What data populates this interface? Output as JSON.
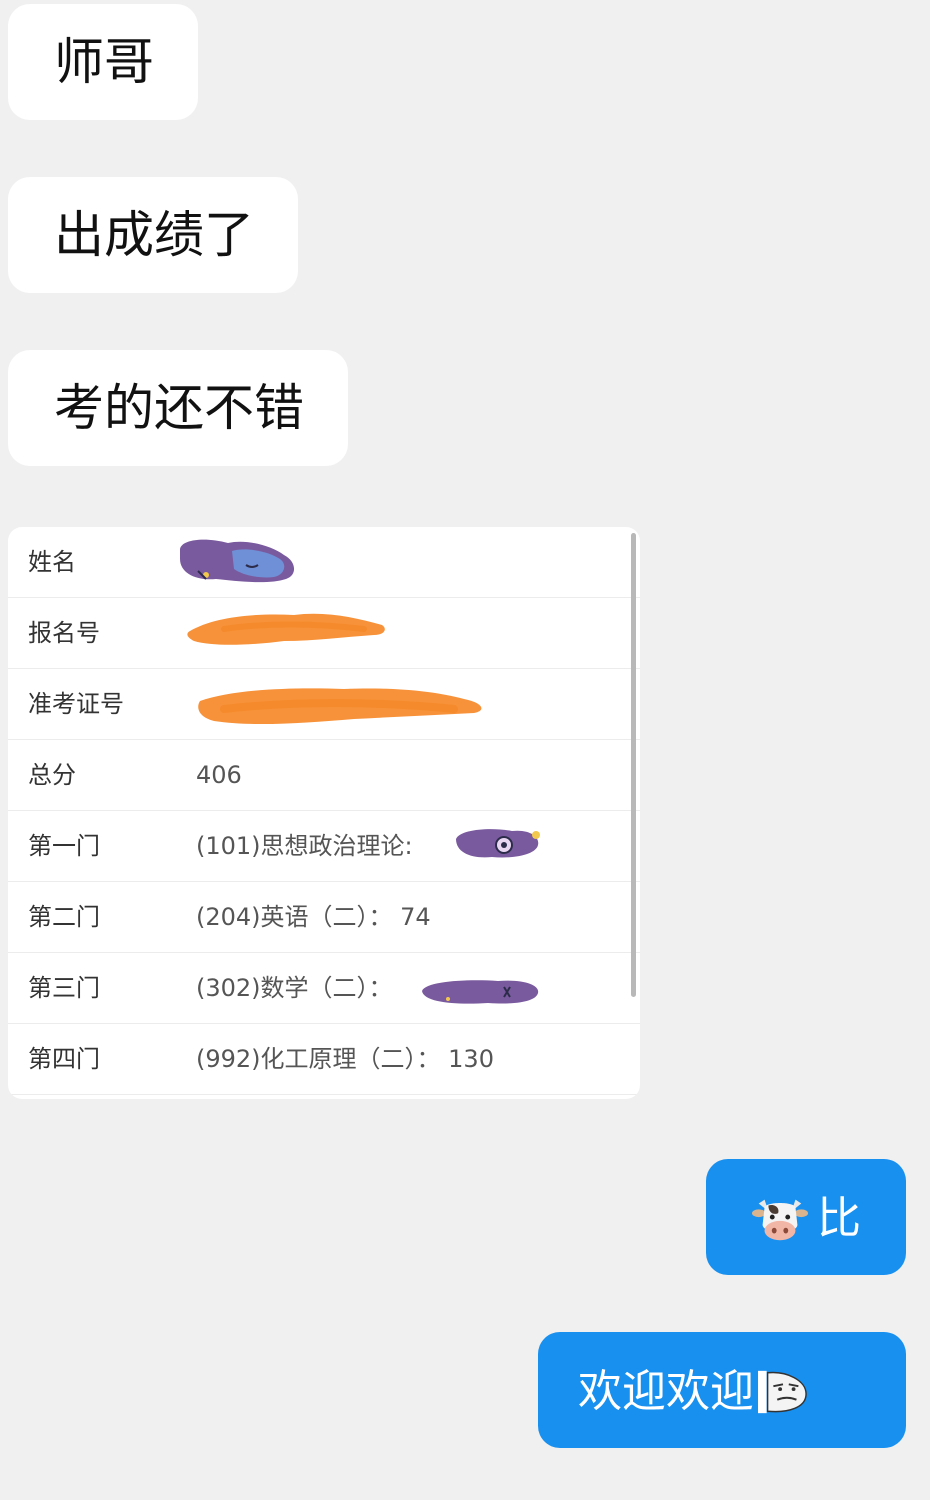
{
  "chat": {
    "incoming": [
      {
        "text": "师哥"
      },
      {
        "text": "出成绩了"
      },
      {
        "text": "考的还不错"
      }
    ],
    "score_card": {
      "rows": [
        {
          "label": "姓名",
          "value": ""
        },
        {
          "label": "报名号",
          "value": ""
        },
        {
          "label": "准考证号",
          "value": ""
        },
        {
          "label": "总分",
          "value": "406"
        },
        {
          "label": "第一门",
          "value": "(101)思想政治理论:"
        },
        {
          "label": "第二门",
          "value": "(204)英语（二）：  74"
        },
        {
          "label": "第三门",
          "value": "(302)数学（二）："
        },
        {
          "label": "第四门",
          "value": "(992)化工原理（二）：  130"
        }
      ]
    },
    "outgoing": [
      {
        "text": "比",
        "icon": "cow-face-icon"
      },
      {
        "text": "欢迎欢迎",
        "icon": "smirk-face-icon"
      }
    ],
    "colors": {
      "background": "#f0f0f0",
      "incoming_bubble": "#ffffff",
      "outgoing_bubble": "#1890f0",
      "redaction_orange": "#f7923a",
      "redaction_purple": "#7a5a9e"
    }
  }
}
